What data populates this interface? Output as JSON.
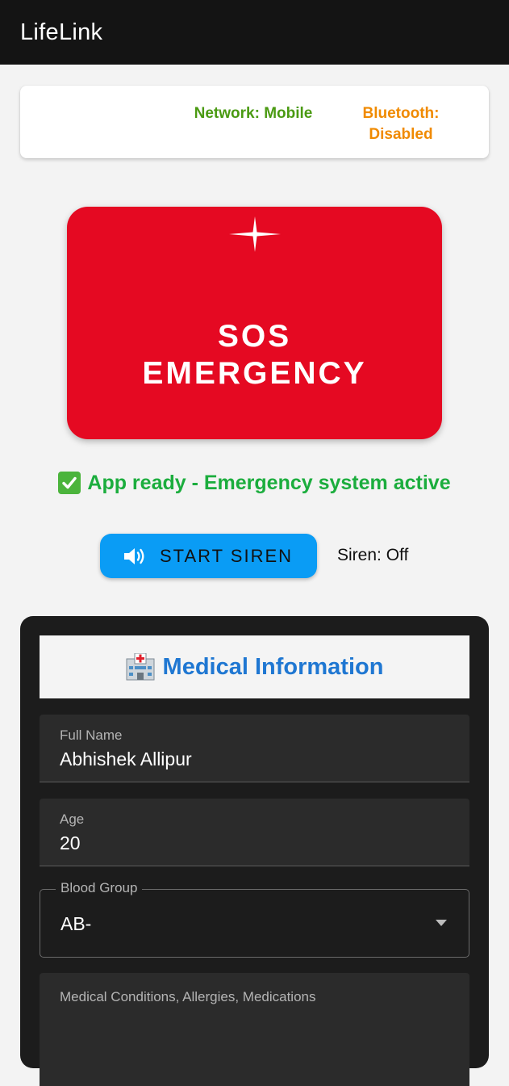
{
  "app": {
    "title": "LifeLink"
  },
  "status": {
    "network": "Network: Mobile",
    "bluetooth_line1": "Bluetooth:",
    "bluetooth_line2": "Disabled",
    "network_color": "#4a9a12",
    "bluetooth_color": "#f08a00"
  },
  "sos": {
    "line1": "SOS",
    "line2": "EMERGENCY",
    "icon": "sparkle-icon",
    "color": "#e50922"
  },
  "app_status": {
    "text": "App ready - Emergency system active",
    "icon": "check-mark-icon"
  },
  "siren": {
    "button_label": "START SIREN",
    "button_icon": "speaker-icon",
    "status": "Siren: Off",
    "button_color": "#0a9cf5"
  },
  "medical": {
    "title": "Medical Information",
    "title_icon": "hospital-icon",
    "full_name": {
      "label": "Full Name",
      "value": "Abhishek Allipur"
    },
    "age": {
      "label": "Age",
      "value": "20"
    },
    "blood_group": {
      "label": "Blood Group",
      "value": "AB-"
    },
    "conditions": {
      "label": "Medical Conditions, Allergies, Medications"
    }
  }
}
